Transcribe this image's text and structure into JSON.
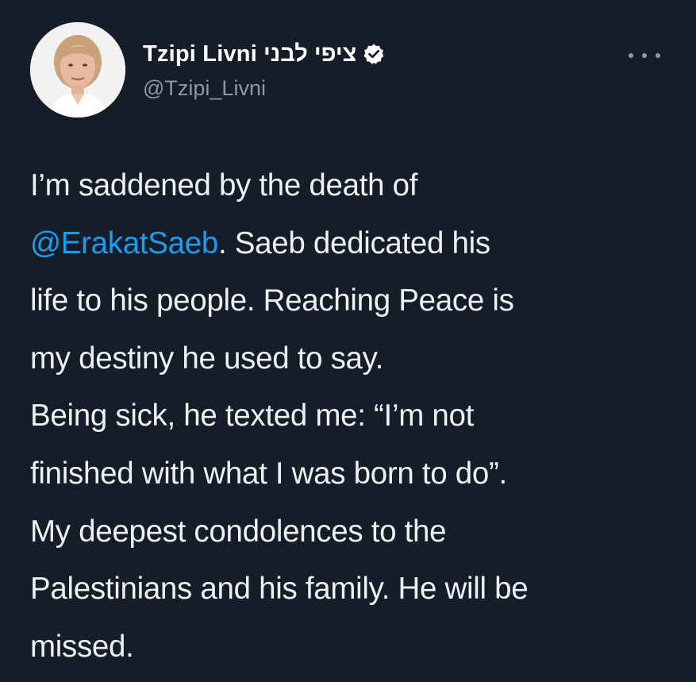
{
  "user": {
    "display_name": "Tzipi Livni",
    "display_name_hebrew": "ציפי לבני",
    "handle": "@Tzipi_Livni",
    "verified": true
  },
  "icons": {
    "verified": "verified-badge-icon",
    "more": "more-options-icon"
  },
  "colors": {
    "background": "#151d28",
    "text": "#eef1f3",
    "secondary_text": "#8b98a5",
    "mention": "#1d9bf0"
  },
  "tweet": {
    "line1": "I’m saddened by the death of",
    "mention": "@ErakatSaeb",
    "line2_rest": ". Saeb dedicated his",
    "line3": "life to his people. Reaching Peace is",
    "line4": "my destiny he used to say.",
    "line5": "Being sick, he texted me: “I’m not",
    "line6": "finished with what I was born to do”.",
    "line7": "My deepest condolences to the",
    "line8": "Palestinians and his family. He will be",
    "line9": "missed."
  }
}
